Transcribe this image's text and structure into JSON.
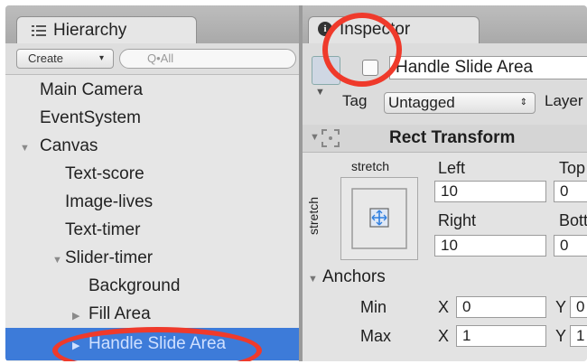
{
  "hierarchy": {
    "tab_title": "Hierarchy",
    "create_label": "Create",
    "search_placeholder": "Q•All",
    "items": [
      {
        "label": "Main Camera"
      },
      {
        "label": "EventSystem"
      },
      {
        "label": "Canvas"
      },
      {
        "label": "Text-score"
      },
      {
        "label": "Image-lives"
      },
      {
        "label": "Text-timer"
      },
      {
        "label": "Slider-timer"
      },
      {
        "label": "Background"
      },
      {
        "label": "Fill Area"
      },
      {
        "label": "Handle Slide Area"
      }
    ]
  },
  "inspector": {
    "tab_title": "Inspector",
    "object_name": "Handle Slide Area",
    "tag_label": "Tag",
    "tag_value": "Untagged",
    "layer_label": "Layer",
    "rect_transform": {
      "title": "Rect Transform",
      "stretch_top": "stretch",
      "stretch_side": "stretch",
      "left_label": "Left",
      "left_value": "10",
      "top_label": "Top",
      "top_value": "0",
      "right_label": "Right",
      "right_value": "10",
      "bottom_label": "Bott",
      "bottom_value": "0"
    },
    "anchors": {
      "title": "Anchors",
      "min_label": "Min",
      "max_label": "Max",
      "x_label": "X",
      "y_label": "Y",
      "min_x": "0",
      "min_y": "0",
      "max_x": "1",
      "max_y": "1"
    }
  },
  "colors": {
    "selection": "#3d7bd9",
    "annotation_circle": "#ef3a2b"
  }
}
